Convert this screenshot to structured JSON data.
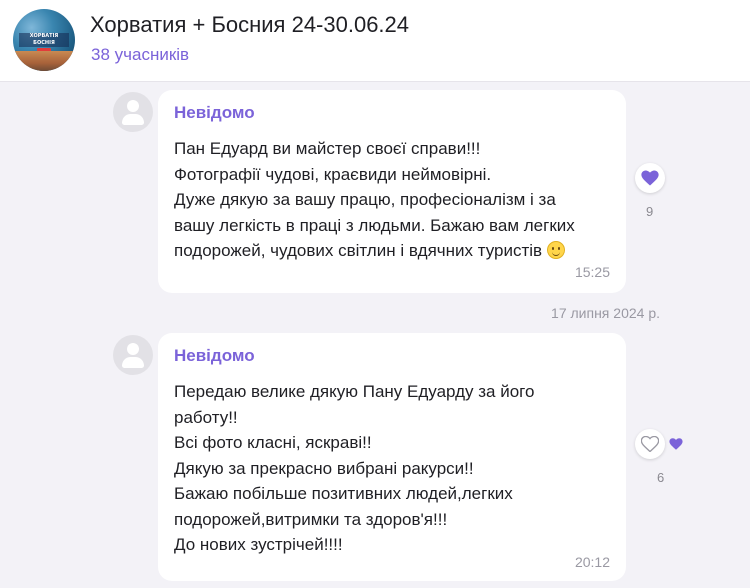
{
  "chat": {
    "title": "Хорватия + Босния 24-30.06.24",
    "members": "38 учасників",
    "avatar_text": "Хорватія\nБоснія"
  },
  "messages": [
    {
      "sender": "Невідомо",
      "text": "Пан Едуард ви майстер своєї справи!!!\nФотографії чудові, краєвиди неймовірні.\nДуже дякую за вашу працю, професіоналізм і за\nвашу легкість в праці з людьми. Бажаю вам легких\nподорожей, чудових світлин і вдячних туристів",
      "emoji": "slightly-smiling-face",
      "time": "15:25",
      "reactions": {
        "icon": "heart-filled",
        "count": "9"
      }
    },
    {
      "sender": "Невідомо",
      "text": "Передаю велике дякую Пану Едуарду за його\nработу!!\nВсі фото класні, яскраві!!\nДякую за прекрасно вибрані ракурси!!\nБажаю  побільше позитивних людей,легких\nподорожей,витримки та здоров'я!!!\nДо нових зустрічей!!!!",
      "time": "20:12",
      "reactions": {
        "icon": "heart-outline",
        "mini_icon": "heart-filled",
        "count": "6"
      }
    }
  ],
  "date_separator": "17 липня 2024 р.",
  "colors": {
    "accent": "#7b63d9",
    "background": "#f3f2f7",
    "bubble": "#ffffff",
    "muted": "#9a99a3"
  }
}
